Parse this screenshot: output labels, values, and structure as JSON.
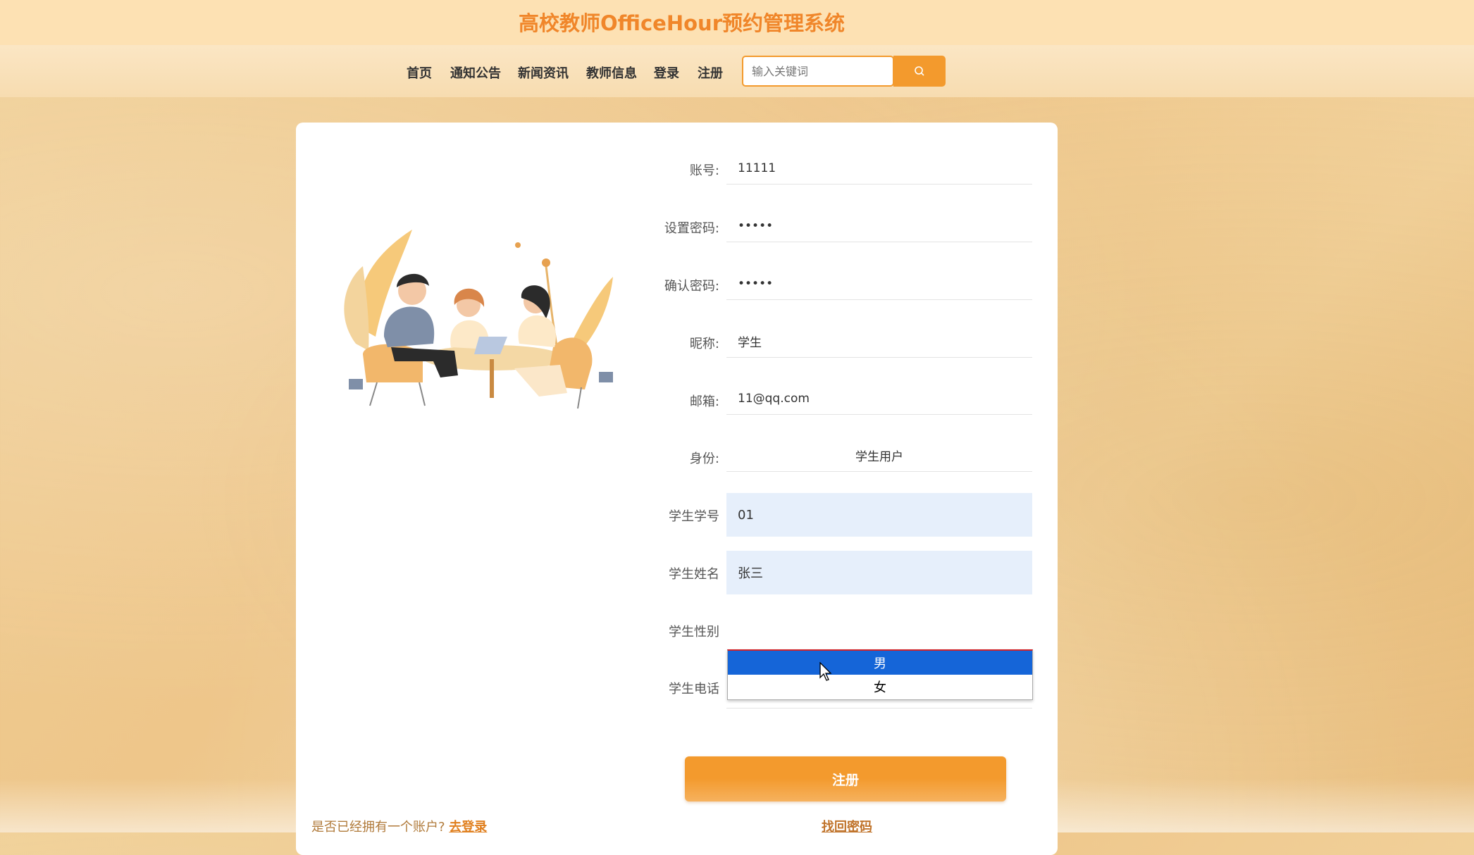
{
  "header": {
    "title": "高校教师OfficeHour预约管理系统"
  },
  "nav": {
    "items": [
      "首页",
      "通知公告",
      "新闻资讯",
      "教师信息",
      "登录",
      "注册"
    ],
    "search_placeholder": "输入关键词"
  },
  "form": {
    "account_label": "账号:",
    "account_value": "11111",
    "password_label": "设置密码:",
    "password_value": "•••••",
    "confirm_label": "确认密码:",
    "confirm_value": "•••••",
    "nickname_label": "昵称:",
    "nickname_value": "学生",
    "email_label": "邮箱:",
    "email_value": "11@qq.com",
    "role_label": "身份:",
    "role_value": "学生用户",
    "student_no_label": "学生学号",
    "student_no_value": "01",
    "student_name_label": "学生姓名",
    "student_name_value": "张三",
    "gender_label": "学生性别",
    "gender_options": [
      "男",
      "女"
    ],
    "gender_selected": "男",
    "phone_label": "学生电话",
    "submit_label": "注册"
  },
  "footer": {
    "has_account_text": "是否已经拥有一个账户?",
    "login_link": "去登录",
    "forgot_link": "找回密码"
  },
  "colors": {
    "accent": "#f39a2d",
    "title": "#f0862a",
    "selected_option": "#1565d8"
  }
}
